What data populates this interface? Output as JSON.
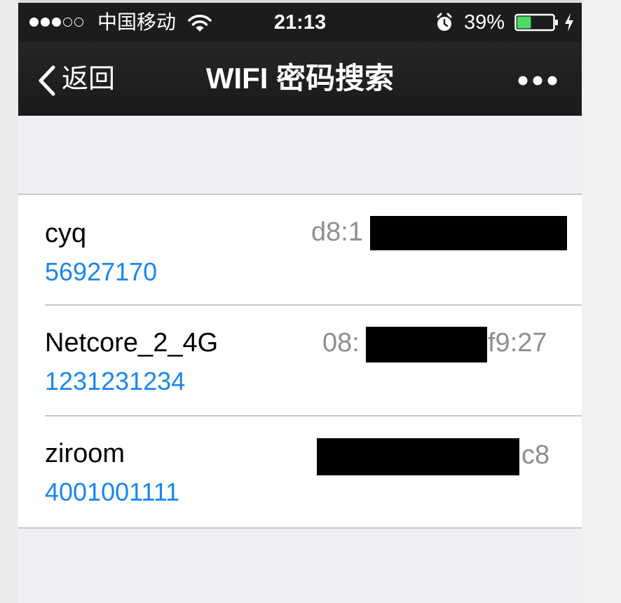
{
  "status_bar": {
    "carrier": "中国移动",
    "time": "21:13",
    "battery": "39%",
    "battery_level": 0.39
  },
  "nav": {
    "back_label": "返回",
    "title": "WIFI 密码搜索"
  },
  "networks": [
    {
      "ssid": "cyq",
      "password": "56927170",
      "mac_prefix": "d8:1",
      "mac_suffix": ""
    },
    {
      "ssid": "Netcore_2_4G",
      "password": "1231231234",
      "mac_prefix": "08:",
      "mac_suffix": "f9:27"
    },
    {
      "ssid": "ziroom",
      "password": "4001001111",
      "mac_prefix": "",
      "mac_suffix": "c8"
    }
  ],
  "colors": {
    "navbar": "#1c1c1e",
    "password_text": "#1a86f0",
    "secondary_text": "#8e8e93",
    "battery_fill": "#4cd964",
    "background": "#efeff4"
  },
  "icons": {
    "signal": "signal-dots-icon",
    "wifi": "wifi-icon",
    "alarm": "alarm-icon",
    "battery": "battery-icon",
    "charging": "charging-bolt-icon",
    "back": "chevron-left-icon",
    "more": "more-dots-icon"
  }
}
